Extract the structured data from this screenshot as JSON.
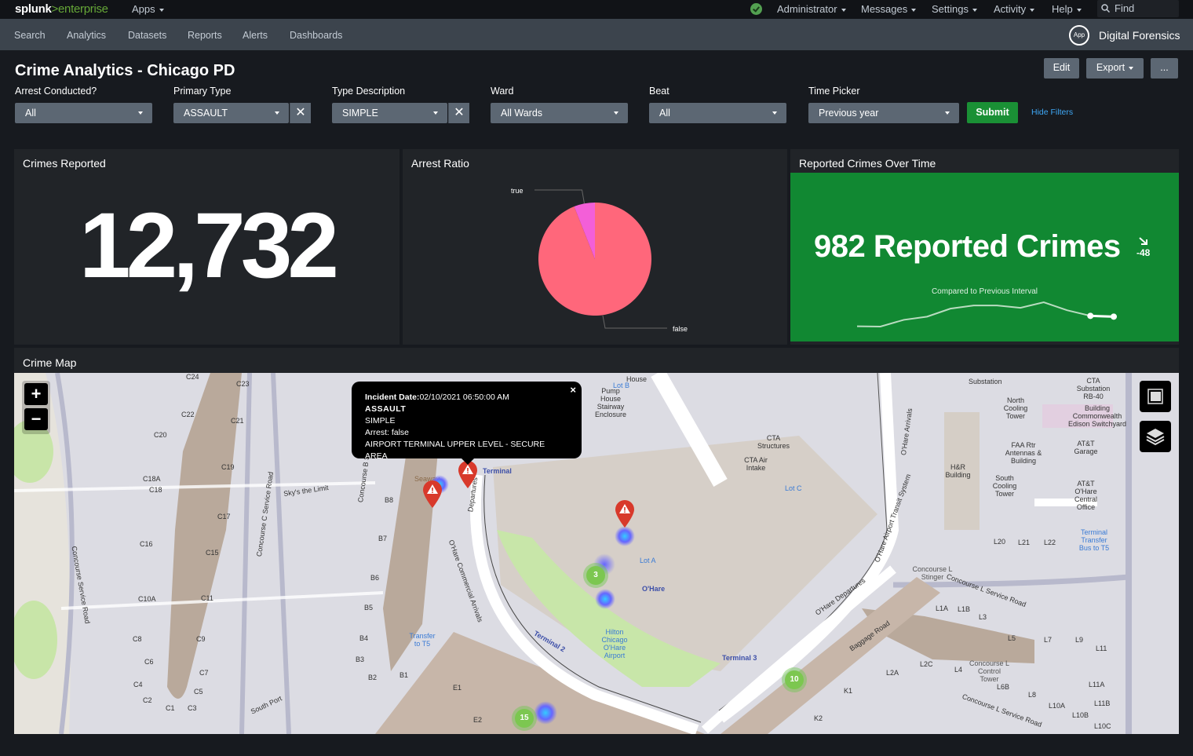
{
  "topbar": {
    "brand_primary": "splunk",
    "brand_separator": ">",
    "brand_secondary": "enterprise",
    "apps_label": "Apps",
    "menus": [
      "Administrator",
      "Messages",
      "Settings",
      "Activity",
      "Help"
    ],
    "find_placeholder": "Find",
    "status_icon": "check-circle-icon",
    "status_color": "#53a051"
  },
  "navbar": {
    "items": [
      "Search",
      "Analytics",
      "Datasets",
      "Reports",
      "Alerts",
      "Dashboards"
    ],
    "app_badge": "App",
    "app_name": "Digital Forensics"
  },
  "dashboard": {
    "title": "Crime Analytics - Chicago PD",
    "actions": {
      "edit": "Edit",
      "export": "Export",
      "more": "..."
    }
  },
  "filters": {
    "arrest": {
      "label": "Arrest Conducted?",
      "value": "All"
    },
    "primary_type": {
      "label": "Primary Type",
      "value": "ASSAULT",
      "clearable": true
    },
    "type_description": {
      "label": "Type Description",
      "value": "SIMPLE",
      "clearable": true
    },
    "ward": {
      "label": "Ward",
      "value": "All Wards"
    },
    "beat": {
      "label": "Beat",
      "value": "All"
    },
    "time_picker": {
      "label": "Time Picker",
      "value": "Previous year"
    },
    "submit_label": "Submit",
    "hide_filters_label": "Hide Filters"
  },
  "panels": {
    "crimes_reported": {
      "title": "Crimes Reported",
      "value": "12,732"
    },
    "arrest_ratio": {
      "title": "Arrest Ratio"
    },
    "over_time": {
      "title": "Reported Crimes Over Time",
      "value_text": "982 Reported Crimes",
      "delta": "-48",
      "trend": "down",
      "compare_label": "Compared to Previous Interval",
      "background": "#118832",
      "sparkline": [
        30,
        28,
        70,
        90,
        140,
        160,
        160,
        145,
        180,
        130,
        95,
        90
      ]
    },
    "crime_map": {
      "title": "Crime Map"
    }
  },
  "chart_data": {
    "type": "pie",
    "title": "Arrest Ratio",
    "slices": [
      {
        "label": "false",
        "value": 94,
        "color": "#ff677b"
      },
      {
        "label": "true",
        "value": 6,
        "color": "#f35fd8"
      }
    ]
  },
  "map": {
    "zoom_in": "+",
    "zoom_out": "−",
    "popup": {
      "date_label": "Incident Date:",
      "date_value": "02/10/2021 06:50:00 AM",
      "type": "ASSAULT",
      "description": "SIMPLE",
      "arrest": "Arrest: false",
      "location": "AIRPORT TERMINAL UPPER LEVEL - SECURE AREA",
      "close": "×"
    },
    "clusters": [
      {
        "count": "3"
      },
      {
        "count": "10"
      },
      {
        "count": "15"
      }
    ],
    "labels": {
      "terminal1": "Terminal",
      "terminal2": "Terminal 2",
      "terminal3": "Terminal 3",
      "ohare": "O'Hare",
      "lot_a": "Lot A",
      "lot_b": "Lot B",
      "lot_c": "Lot C",
      "hilton": "Hilton Chicago O'Hare Airport",
      "transfer_t5": "Transfer to T5",
      "terminal_transfer": "Terminal Transfer Bus to T5",
      "hr_building": "H&R Building",
      "north_cooling": "North Cooling Tower",
      "south_cooling": "South Cooling Tower",
      "faa": "FAA Rtr Antennas & Building",
      "att_garage": "AT&T Garage",
      "att_office": "AT&T O'Hare Central Office",
      "cta_substation": "CTA Substation RB-40",
      "comed": "Building Commonwealth Edison Switchyard",
      "substation": "Substation",
      "cta_structures": "CTA Structures",
      "cta_air": "CTA Air Intake",
      "pump_house": "Pump House Stairway Enclosure",
      "house": "House",
      "skys_limit": "Sky's the Limit",
      "concourse_c_road": "Concourse C Service Road",
      "concourse_service": "Concourse Service Road",
      "concourse_b": "Concourse B S",
      "south_port": "South Port",
      "ohare_commercial_arrivals": "O'Hare Commercial Arrivals",
      "departures": "Departures",
      "ohare_departures": "O'Hare Departures",
      "ohare_arrivals": "O'Hare Arrivals",
      "airport_transit": "O'Hare Airport Transit System",
      "baggage_road": "Baggage Road",
      "concourse_l_stinger": "Concourse L Stinger",
      "concourse_l_road": "Concourse L Service Road",
      "concourse_l_tower": "Concourse L Control Tower",
      "seaway": "Seaway"
    },
    "gates": [
      "C24",
      "C23",
      "C22",
      "C21",
      "C20",
      "C19",
      "C18A",
      "C18",
      "C17",
      "C16",
      "C15",
      "C11",
      "C10A",
      "C9",
      "C8",
      "C7",
      "C6",
      "C5",
      "C4",
      "C3",
      "C2",
      "C1",
      "B8",
      "B7",
      "B6",
      "B5",
      "B4",
      "B3",
      "B2",
      "B1",
      "E1",
      "E2",
      "K1",
      "K2",
      "L1A",
      "L1B",
      "L3",
      "L2C",
      "L2A",
      "L4",
      "L5",
      "L6B",
      "L7",
      "L8",
      "L9",
      "L10A",
      "L10B",
      "L10C",
      "L11",
      "L11A",
      "L11B",
      "L20",
      "L21",
      "L22"
    ]
  }
}
